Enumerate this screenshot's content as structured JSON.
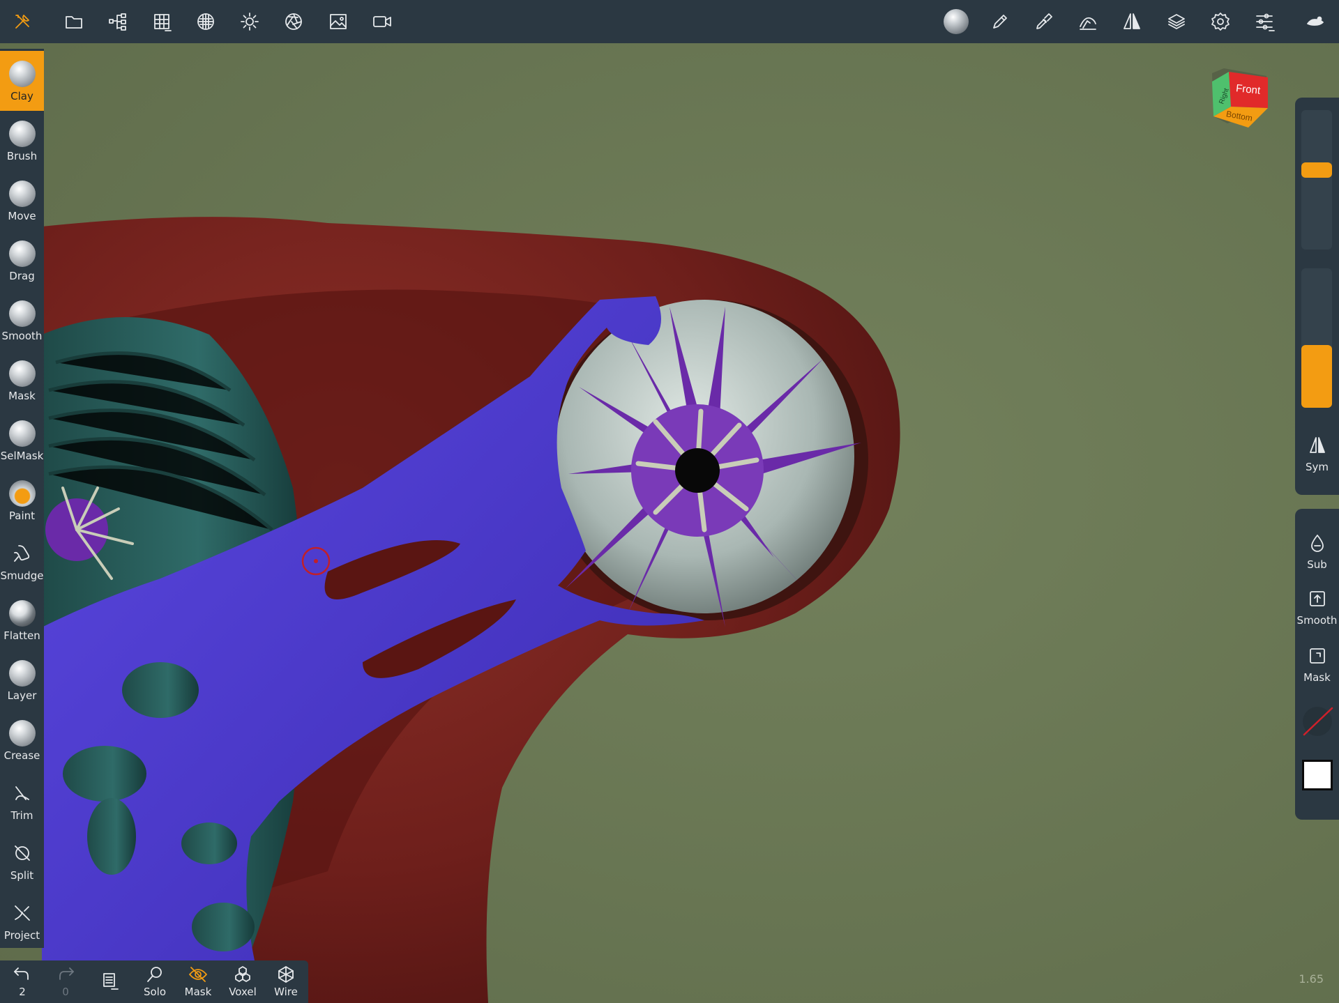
{
  "toolbar_left": [
    {
      "name": "tools-icon"
    },
    {
      "name": "folder-icon"
    },
    {
      "name": "scene-tree-icon"
    },
    {
      "name": "grid-icon"
    },
    {
      "name": "material-sphere-icon"
    },
    {
      "name": "light-icon"
    },
    {
      "name": "aperture-icon"
    },
    {
      "name": "image-icon"
    },
    {
      "name": "video-icon"
    }
  ],
  "toolbar_right": [
    {
      "name": "matcap-sphere-icon"
    },
    {
      "name": "pencil-icon"
    },
    {
      "name": "brush-settings-icon"
    },
    {
      "name": "stroke-icon"
    },
    {
      "name": "symmetry-icon"
    },
    {
      "name": "layers-icon"
    },
    {
      "name": "gear-icon"
    },
    {
      "name": "sliders-icon"
    },
    {
      "name": "more-icon"
    }
  ],
  "tools": [
    {
      "label": "Clay",
      "active": true
    },
    {
      "label": "Brush"
    },
    {
      "label": "Move"
    },
    {
      "label": "Drag"
    },
    {
      "label": "Smooth"
    },
    {
      "label": "Mask"
    },
    {
      "label": "SelMask"
    },
    {
      "label": "Paint"
    },
    {
      "label": "Smudge"
    },
    {
      "label": "Flatten"
    },
    {
      "label": "Layer"
    },
    {
      "label": "Crease"
    },
    {
      "label": "Trim"
    },
    {
      "label": "Split"
    },
    {
      "label": "Project"
    }
  ],
  "bottom": {
    "undo_count": "2",
    "redo_count": "0",
    "solo": "Solo",
    "mask": "Mask",
    "voxel": "Voxel",
    "wire": "Wire"
  },
  "right_panel": {
    "radius_level": 0.58,
    "intensity_level": 0.45,
    "sym": "Sym",
    "sub": "Sub",
    "smooth": "Smooth",
    "mask": "Mask"
  },
  "navcube": {
    "front": "Front",
    "right": "Right",
    "bottom": "Bottom"
  },
  "version": "1.65",
  "colors": {
    "accent": "#f39c12",
    "panel": "#2b3842",
    "background": "#6c7a56"
  }
}
